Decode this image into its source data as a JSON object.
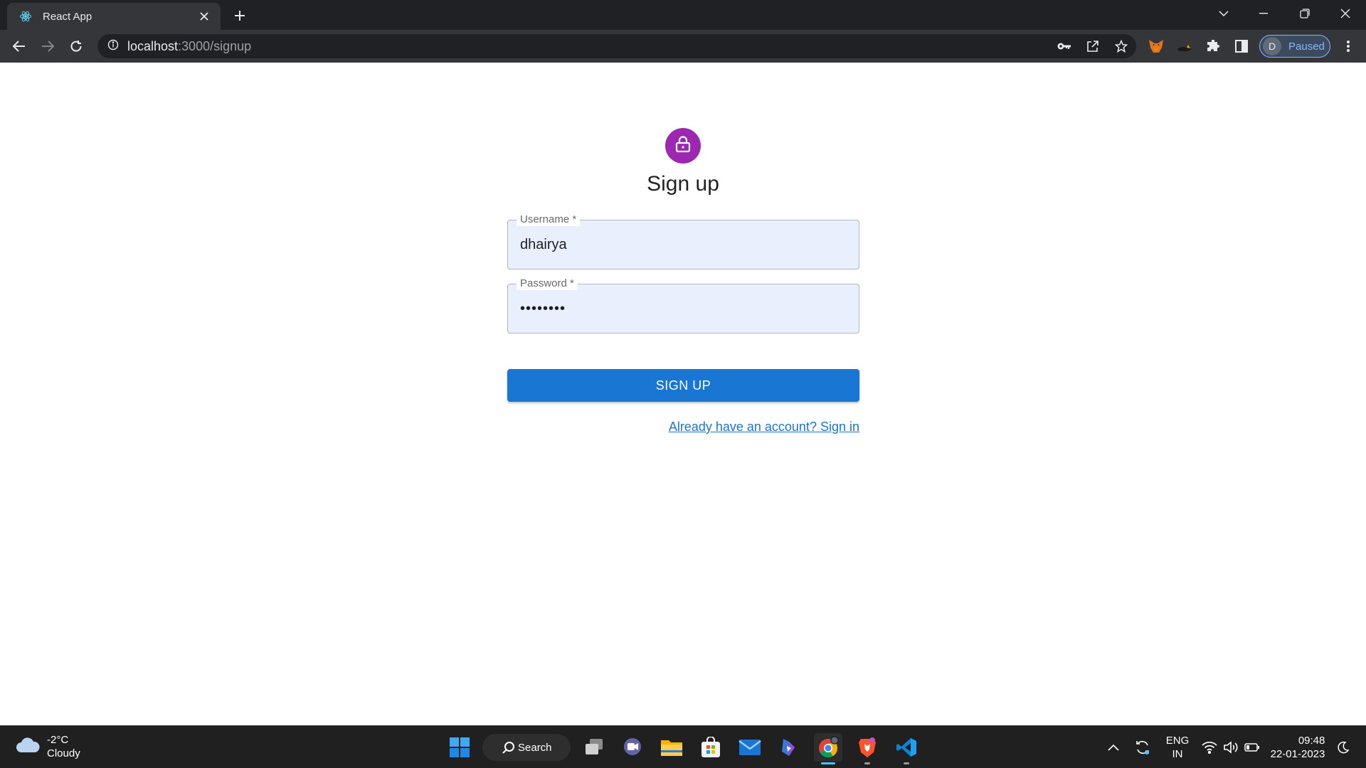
{
  "browser": {
    "tab_title": "React App",
    "url_host": "localhost",
    "url_path": ":3000/signup",
    "profile_initial": "D",
    "profile_status": "Paused"
  },
  "page": {
    "title": "Sign up",
    "username": {
      "label": "Username *",
      "value": "dhairya"
    },
    "password": {
      "label": "Password *",
      "value": "••••••••"
    },
    "submit_label": "SIGN UP",
    "signin_link": "Already have an account? Sign in"
  },
  "taskbar": {
    "weather_temp": "-2°C",
    "weather_desc": "Cloudy",
    "search_label": "Search",
    "lang_line1": "ENG",
    "lang_line2": "IN",
    "time": "09:48",
    "date": "22-01-2023"
  },
  "colors": {
    "primary": "#1976d2",
    "avatar": "#9c27b0",
    "autofill": "#e8f0fe"
  }
}
